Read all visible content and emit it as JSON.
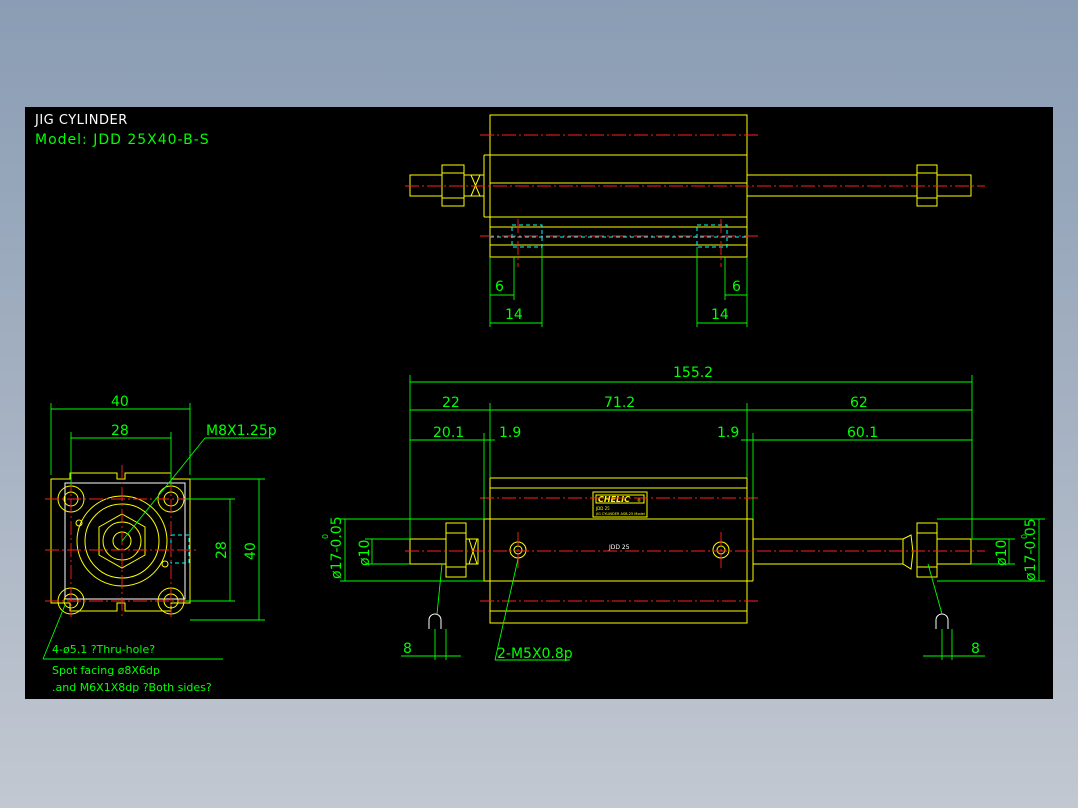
{
  "title": "JIG CYLINDER",
  "model": "Model:  JDD 25X40-B-S",
  "colors": {
    "background": "#000000",
    "outline": "#ffff00",
    "dimension": "#00ff00",
    "centerline": "#ff2020",
    "hidden": "#00ffff",
    "text": "#ffffff"
  },
  "top_view": {
    "dims": {
      "left_inner": "6",
      "left_outer": "14",
      "right_inner": "6",
      "right_outer": "14"
    }
  },
  "end_view": {
    "dims": {
      "width": "40",
      "bolt_pitch": "28",
      "height": "40",
      "bolt_pitch_v": "28",
      "thread": "M8X1.25p"
    },
    "notes": {
      "holes": "4-ø5.1 ?Thru-hole?",
      "spot": "Spot facing  ø8X6dp",
      "tap": ".and M6X1X8dp ?Both sides?"
    }
  },
  "front_view": {
    "dims": {
      "overall": "155.2",
      "left": "22",
      "body": "71.2",
      "right": "62",
      "left_rod": "20.1",
      "gap_left": "1.9",
      "gap_right": "1.9",
      "right_rod": "60.1",
      "flat_left": "8",
      "flat_right": "8",
      "ports": "2-M5X0.8p",
      "rod_dia_left": "ø10",
      "rod_dia_right": "ø10",
      "bore_left": "ø17-0.05",
      "bore_left_tol_top": "0",
      "bore_right": "ø17-0.05",
      "bore_right_tol_top": "0",
      "bore_label": "JDD 25"
    },
    "nameplate": {
      "brand": "CHELIC",
      "sub": "®",
      "line1": "JDD 25",
      "line2": "JIG CYLINDER  ASB-25  Model"
    }
  }
}
